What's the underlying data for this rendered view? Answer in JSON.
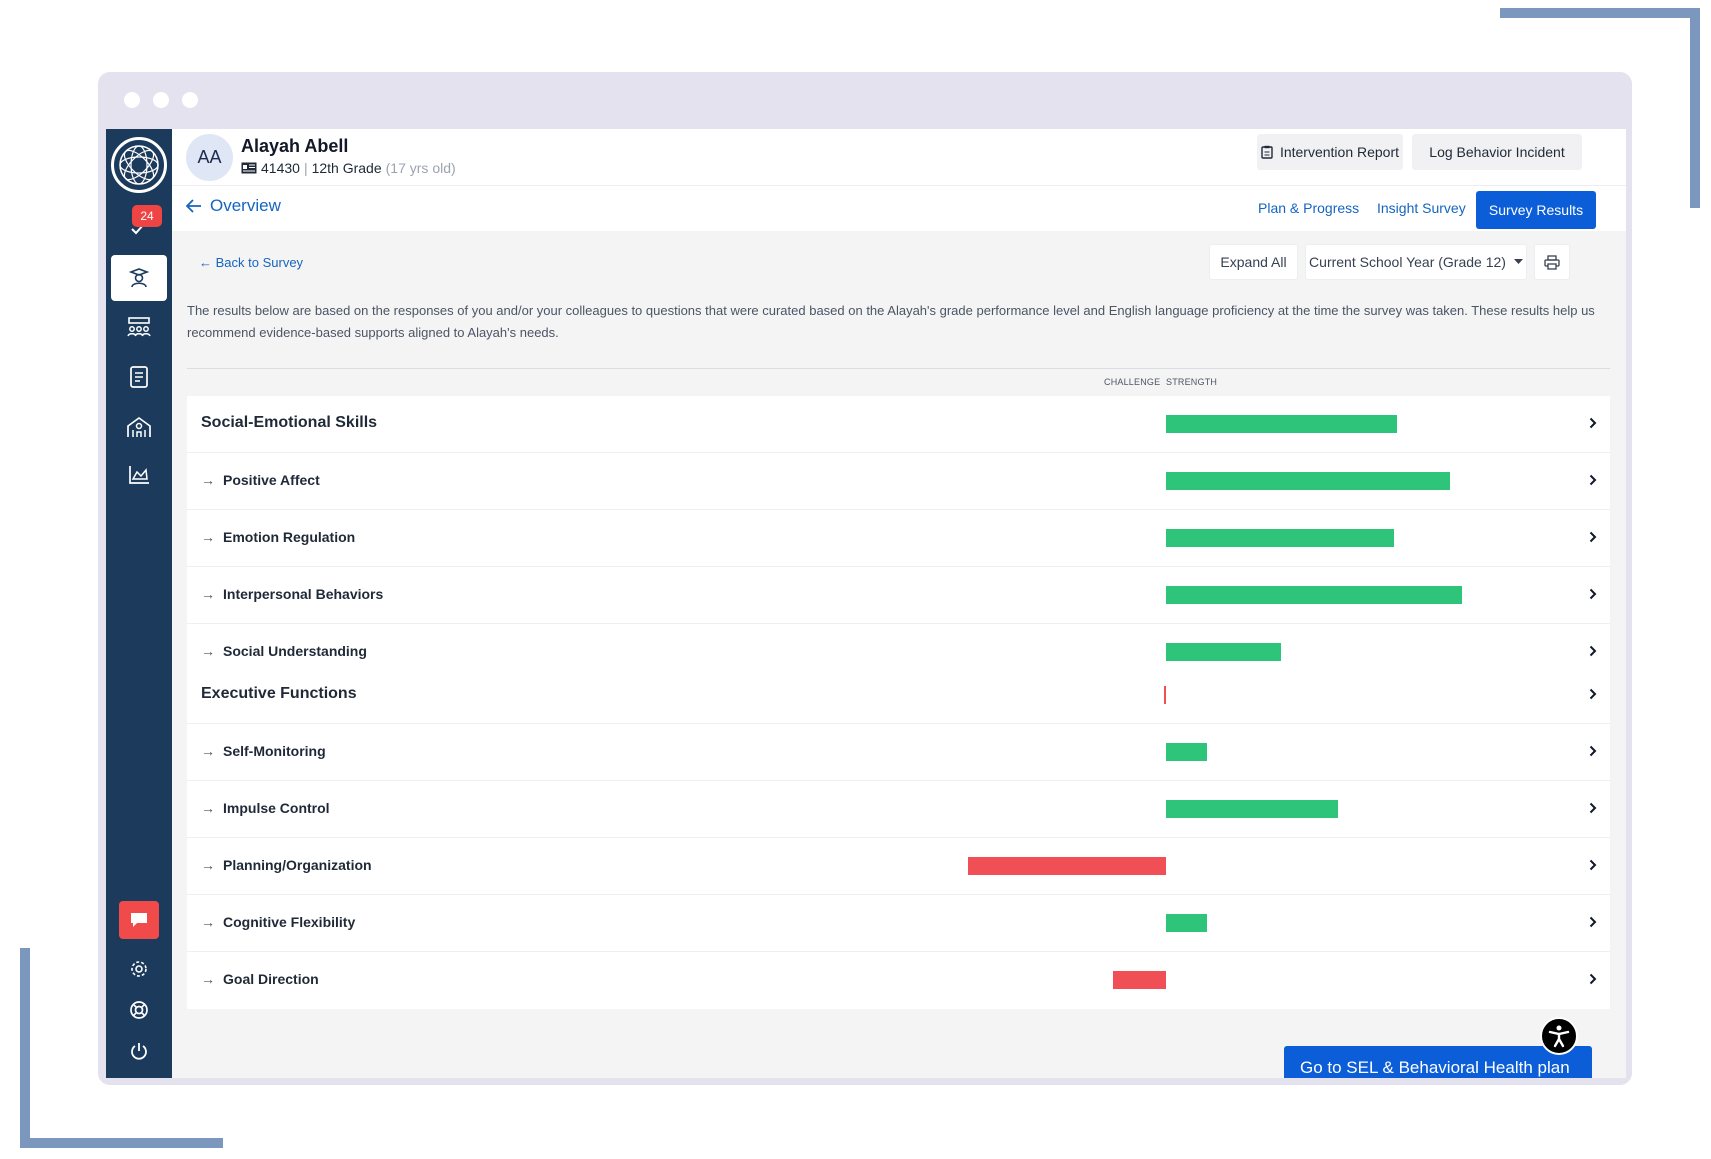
{
  "student": {
    "initials": "AA",
    "name": "Alayah Abell",
    "id": "41430",
    "separator": "|",
    "grade": "12th Grade",
    "age": "(17 yrs old)"
  },
  "header_buttons": {
    "intervention_report": "Intervention Report",
    "log_behavior_incident": "Log Behavior Incident"
  },
  "sidebar": {
    "badge_count": "24"
  },
  "subnav": {
    "overview": "Overview",
    "tabs": [
      "Plan & Progress",
      "Insight Survey",
      "Survey Results"
    ],
    "active_tab": "Survey Results"
  },
  "toolbar": {
    "back": "Back to Survey",
    "expand_all": "Expand All",
    "year_select": "Current School Year (Grade 12)"
  },
  "description": "The results below are based on the responses of you and/or your colleagues to questions that were curated based on the Alayah's grade performance level and English language proficiency at the time the survey was taken. These results help us recommend evidence-based supports aligned to Alayah's needs.",
  "axis": {
    "challenge": "CHALLENGE",
    "strength": "STRENGTH"
  },
  "colors": {
    "strength": "#2ec57a",
    "challenge": "#f04f55",
    "primary": "#0b5ed7",
    "sidebar": "#1b3a5c"
  },
  "chart_data": {
    "type": "bar",
    "groups": [
      {
        "name": "Social-Emotional Skills",
        "score": 0.78,
        "items": [
          {
            "name": "Positive Affect",
            "score": 0.96
          },
          {
            "name": "Emotion Regulation",
            "score": 0.77
          },
          {
            "name": "Interpersonal Behaviors",
            "score": 1.0
          },
          {
            "name": "Social Understanding",
            "score": 0.39
          }
        ]
      },
      {
        "name": "Executive Functions",
        "score": -0.005,
        "items": [
          {
            "name": "Self-Monitoring",
            "score": 0.14
          },
          {
            "name": "Impulse Control",
            "score": 0.58
          },
          {
            "name": "Planning/Organization",
            "score": -0.67
          },
          {
            "name": "Cognitive Flexibility",
            "score": 0.14
          },
          {
            "name": "Goal Direction",
            "score": -0.18
          }
        ]
      }
    ]
  },
  "cta": {
    "label": "Go to SEL & Behavioral Health plan"
  }
}
